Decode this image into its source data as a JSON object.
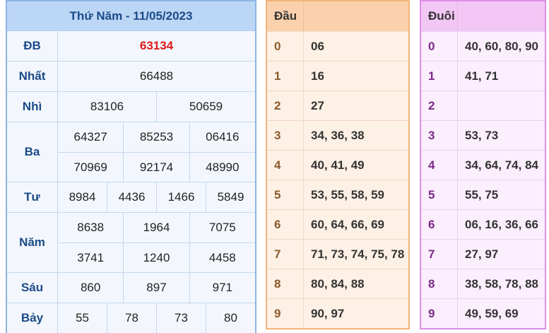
{
  "results": {
    "title": "Thứ Năm - 11/05/2023",
    "prizes": [
      {
        "label": "ĐB",
        "lines": [
          [
            "63134"
          ]
        ]
      },
      {
        "label": "Nhất",
        "lines": [
          [
            "66488"
          ]
        ]
      },
      {
        "label": "Nhì",
        "lines": [
          [
            "83106",
            "50659"
          ]
        ]
      },
      {
        "label": "Ba",
        "lines": [
          [
            "64327",
            "85253",
            "06416"
          ],
          [
            "70969",
            "92174",
            "48990"
          ]
        ]
      },
      {
        "label": "Tư",
        "lines": [
          [
            "8984",
            "4436",
            "1466",
            "5849"
          ]
        ]
      },
      {
        "label": "Năm",
        "lines": [
          [
            "8638",
            "1964",
            "7075"
          ],
          [
            "3741",
            "1240",
            "4458"
          ]
        ]
      },
      {
        "label": "Sáu",
        "lines": [
          [
            "860",
            "897",
            "971"
          ]
        ]
      },
      {
        "label": "Bảy",
        "lines": [
          [
            "55",
            "78",
            "73",
            "80"
          ]
        ]
      }
    ]
  },
  "dau": {
    "header": "Đầu",
    "rows": [
      {
        "k": "0",
        "v": "06"
      },
      {
        "k": "1",
        "v": "16"
      },
      {
        "k": "2",
        "v": "27"
      },
      {
        "k": "3",
        "v": "34, 36, 38"
      },
      {
        "k": "4",
        "v": "40, 41, 49"
      },
      {
        "k": "5",
        "v": "53, 55, 58, 59"
      },
      {
        "k": "6",
        "v": "60, 64, 66, 69"
      },
      {
        "k": "7",
        "v": "71, 73, 74, 75, 78"
      },
      {
        "k": "8",
        "v": "80, 84, 88"
      },
      {
        "k": "9",
        "v": "90, 97"
      }
    ]
  },
  "duoi": {
    "header": "Đuôi",
    "rows": [
      {
        "k": "0",
        "v": "40, 60, 80, 90"
      },
      {
        "k": "1",
        "v": "41, 71"
      },
      {
        "k": "2",
        "v": ""
      },
      {
        "k": "3",
        "v": "53, 73"
      },
      {
        "k": "4",
        "v": "34, 64, 74, 84"
      },
      {
        "k": "5",
        "v": "55, 75"
      },
      {
        "k": "6",
        "v": "06, 16, 36, 66"
      },
      {
        "k": "7",
        "v": "27, 97"
      },
      {
        "k": "8",
        "v": "38, 58, 78, 88"
      },
      {
        "k": "9",
        "v": "49, 59, 69"
      }
    ]
  }
}
